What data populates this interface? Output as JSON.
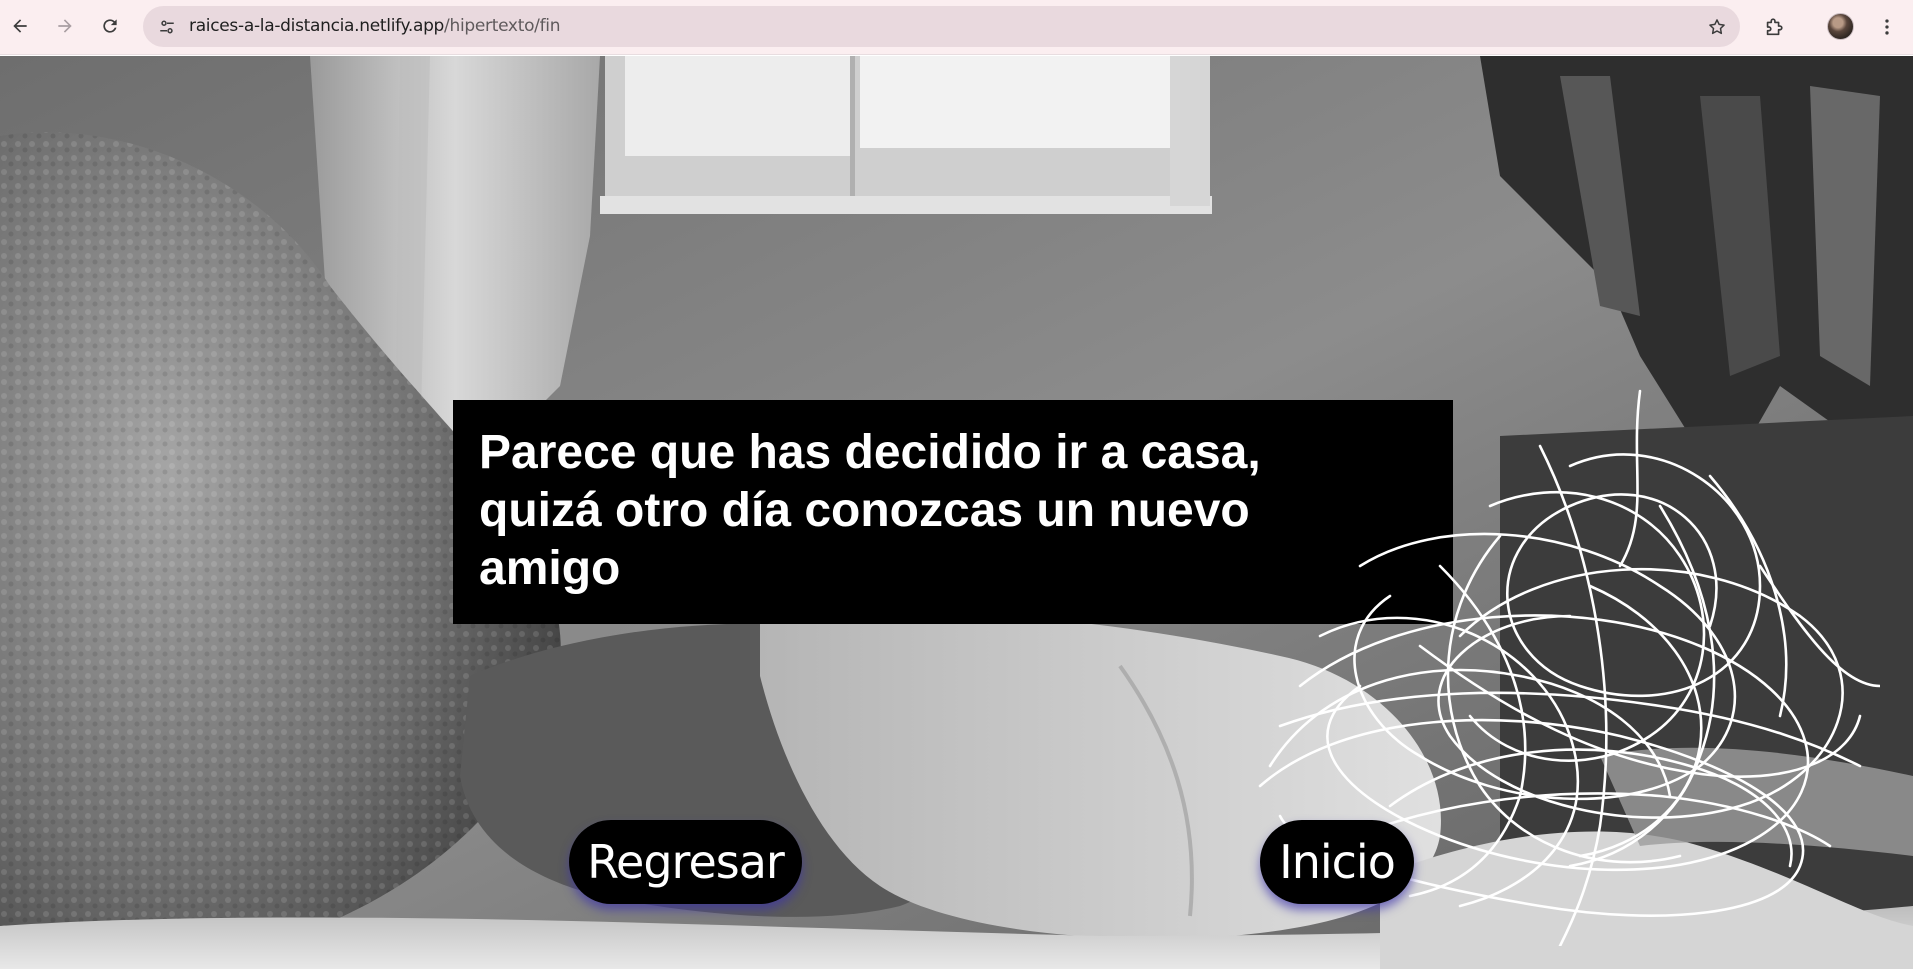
{
  "browser": {
    "url_host": "raices-a-la-distancia.netlify.app",
    "url_path": "/hipertexto/fin"
  },
  "page": {
    "message": "Parece que has decidido ir a casa, quizá otro día conozcas un nuevo amigo",
    "buttons": {
      "back_label": "Regresar",
      "home_label": "Inicio"
    }
  },
  "colors": {
    "toolbar_bg": "#fbeef0",
    "omnibox_bg": "#e9d9de",
    "message_bg": "#000000",
    "button_shadow": "#3c32aa"
  }
}
